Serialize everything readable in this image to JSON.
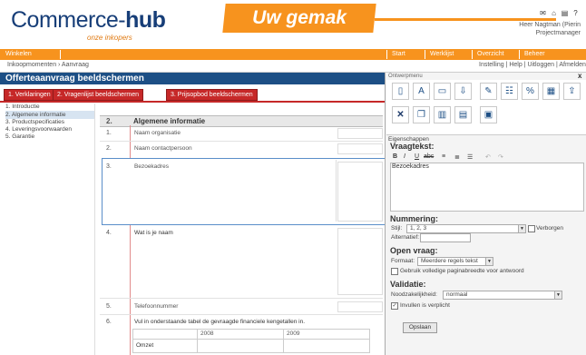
{
  "header": {
    "logo_part1": "Commerce-",
    "logo_part2": "hub",
    "logo_tag": "onze inkopers",
    "banner": "Uw gemak",
    "user_line1": "Heer Nagtman (Pierin",
    "user_line2": "Projectmanager",
    "icons": [
      "mail-icon",
      "home-icon",
      "print-icon",
      "help-icon"
    ]
  },
  "nav": {
    "items": [
      "Winkelen",
      "Start",
      "Werklijst",
      "Overzicht",
      "Beheer"
    ],
    "breadcrumb": "Inkoopmomenten › Aanvraag",
    "right_links": "Instelling | Help | Uitloggen",
    "right_highlight": "Afmelden"
  },
  "title": "Offerteaanvraag beeldschermen",
  "tabs": [
    "1. Verklaringen",
    "2. Vragenlijst beeldschermen",
    "3. Prijsopbod beeldschermen"
  ],
  "left_nav": [
    "1. Introductie",
    "2. Algemene informatie",
    "3. Productspecificaties",
    "4. Leveringsvoorwaarden",
    "5. Garantie"
  ],
  "form": {
    "section_number": "2.",
    "section_title": "Algemene informatie",
    "questions": [
      {
        "num": "1.",
        "label": "Naam organisatie"
      },
      {
        "num": "2.",
        "label": "Naam contactpersoon"
      },
      {
        "num": "3.",
        "label": "Bezoekadres"
      },
      {
        "num": "4.",
        "label": "Wat is je naam"
      },
      {
        "num": "5.",
        "label": "Telefoonnummer"
      },
      {
        "num": "6.",
        "label": "Vul in onderstaande tabel de gevraagde financiele kengetallen in."
      }
    ],
    "table_headers": [
      "2008",
      "2009"
    ],
    "table_row": "Omzet"
  },
  "panel": {
    "title": "Ontwerpmenu",
    "close": "x",
    "icons": [
      "page-icon",
      "text-icon",
      "textbox-icon",
      "upload-icon",
      "edit-icon",
      "grid-icon",
      "percent-icon",
      "table-icon",
      "export-icon",
      "delete-icon",
      "copy-icon",
      "chart-icon",
      "chart2-icon",
      "doc-icon"
    ],
    "eigenschappen": "Eigenschappen",
    "vraagtekst_head": "Vraagtekst:",
    "toolbar": [
      "B",
      "I",
      "U",
      "abc",
      "≡",
      "≣",
      "☰",
      "↶",
      "↷"
    ],
    "question_text": "Bezoekadres",
    "nummering_head": "Nummering:",
    "stijl_label": "Stijl:",
    "stijl_value": "1, 2, 3",
    "verborgen_label": "Verborgen",
    "alternatief_label": "Alternatief:",
    "open_head": "Open vraag:",
    "formaat_label": "Formaat:",
    "formaat_value": "Meerdere regels tekst",
    "volledige_label": "Gebruik volledige paginabreedte voor antwoord",
    "validatie_head": "Validatie:",
    "noodzakelijk_label": "Noodzakelijkheid:",
    "noodzakelijk_value": "normaal",
    "invullen_label": "Invullen is verplicht",
    "save_button": "Opslaan"
  }
}
